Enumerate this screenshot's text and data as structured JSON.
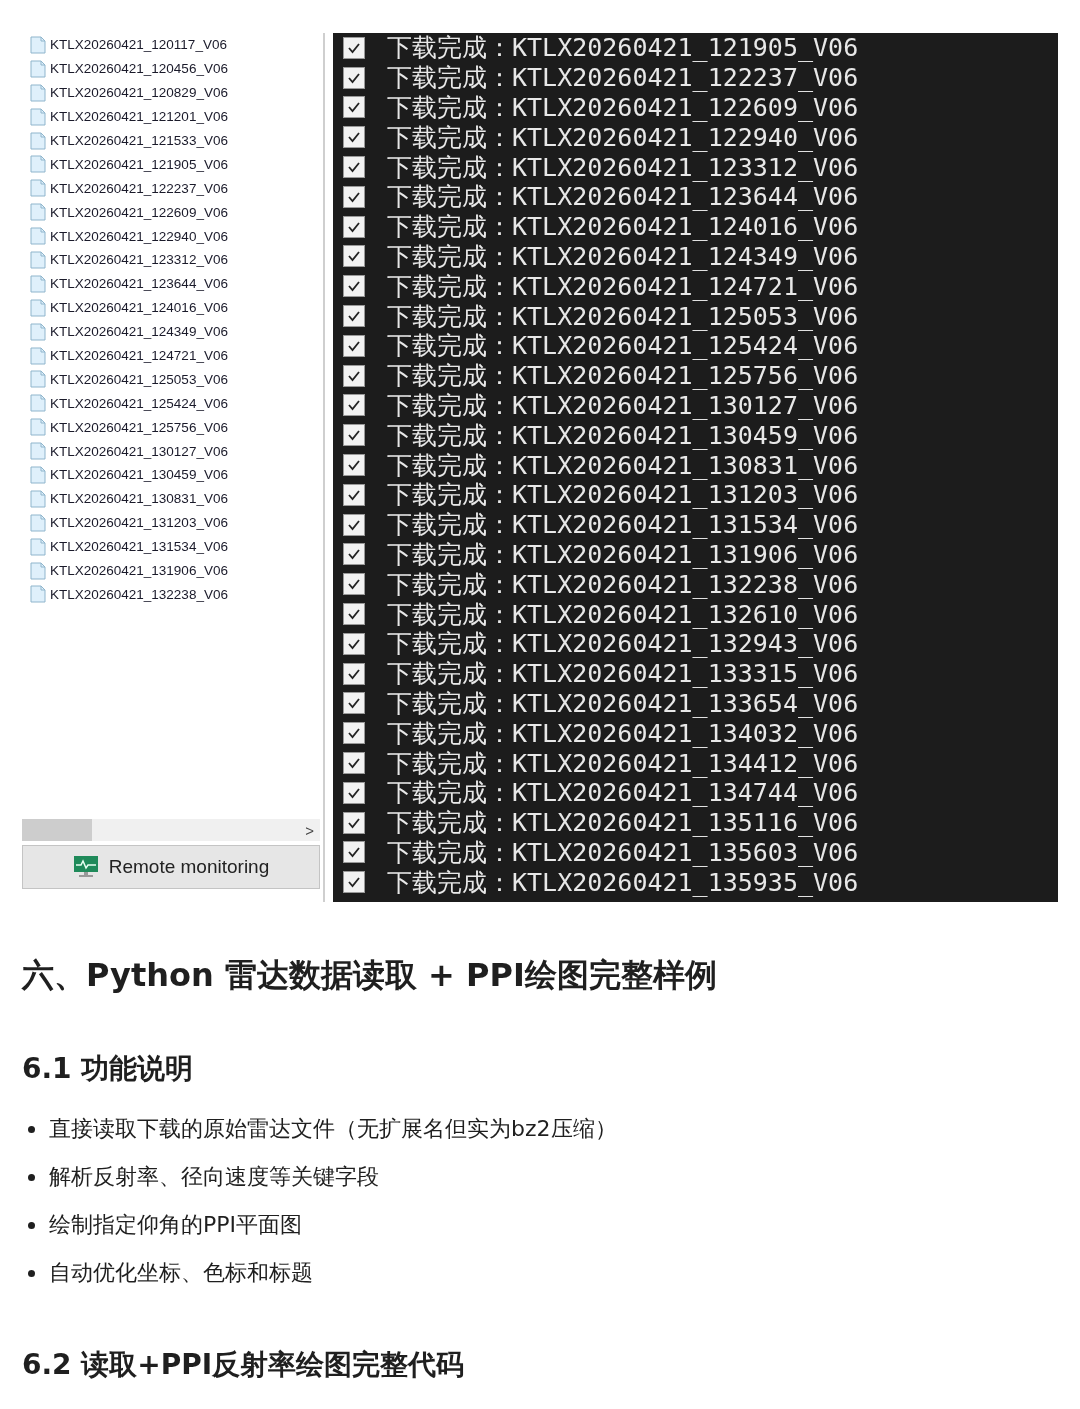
{
  "screenshot": {
    "file_list": [
      "KTLX20260421_120117_V06",
      "KTLX20260421_120456_V06",
      "KTLX20260421_120829_V06",
      "KTLX20260421_121201_V06",
      "KTLX20260421_121533_V06",
      "KTLX20260421_121905_V06",
      "KTLX20260421_122237_V06",
      "KTLX20260421_122609_V06",
      "KTLX20260421_122940_V06",
      "KTLX20260421_123312_V06",
      "KTLX20260421_123644_V06",
      "KTLX20260421_124016_V06",
      "KTLX20260421_124349_V06",
      "KTLX20260421_124721_V06",
      "KTLX20260421_125053_V06",
      "KTLX20260421_125424_V06",
      "KTLX20260421_125756_V06",
      "KTLX20260421_130127_V06",
      "KTLX20260421_130459_V06",
      "KTLX20260421_130831_V06",
      "KTLX20260421_131203_V06",
      "KTLX20260421_131534_V06",
      "KTLX20260421_131906_V06",
      "KTLX20260421_132238_V06"
    ],
    "scroll_arrow": ">",
    "panel_button": "Remote monitoring",
    "terminal_lines": [
      {
        "checked": true,
        "text": "下载完成：KTLX20260421_121905_V06"
      },
      {
        "checked": true,
        "text": "下载完成：KTLX20260421_122237_V06"
      },
      {
        "checked": true,
        "text": "下载完成：KTLX20260421_122609_V06"
      },
      {
        "checked": true,
        "text": "下载完成：KTLX20260421_122940_V06"
      },
      {
        "checked": true,
        "text": "下载完成：KTLX20260421_123312_V06"
      },
      {
        "checked": true,
        "text": "下载完成：KTLX20260421_123644_V06"
      },
      {
        "checked": true,
        "text": "下载完成：KTLX20260421_124016_V06"
      },
      {
        "checked": true,
        "text": "下载完成：KTLX20260421_124349_V06"
      },
      {
        "checked": true,
        "text": "下载完成：KTLX20260421_124721_V06"
      },
      {
        "checked": true,
        "text": "下载完成：KTLX20260421_125053_V06"
      },
      {
        "checked": true,
        "text": "下载完成：KTLX20260421_125424_V06"
      },
      {
        "checked": true,
        "text": "下载完成：KTLX20260421_125756_V06"
      },
      {
        "checked": true,
        "text": "下载完成：KTLX20260421_130127_V06"
      },
      {
        "checked": true,
        "text": "下载完成：KTLX20260421_130459_V06"
      },
      {
        "checked": true,
        "text": "下载完成：KTLX20260421_130831_V06"
      },
      {
        "checked": true,
        "text": "下载完成：KTLX20260421_131203_V06"
      },
      {
        "checked": true,
        "text": "下载完成：KTLX20260421_131534_V06"
      },
      {
        "checked": true,
        "text": "下载完成：KTLX20260421_131906_V06"
      },
      {
        "checked": true,
        "text": "下载完成：KTLX20260421_132238_V06"
      },
      {
        "checked": true,
        "text": "下载完成：KTLX20260421_132610_V06"
      },
      {
        "checked": true,
        "text": "下载完成：KTLX20260421_132943_V06"
      },
      {
        "checked": true,
        "text": "下载完成：KTLX20260421_133315_V06"
      },
      {
        "checked": true,
        "text": "下载完成：KTLX20260421_133654_V06"
      },
      {
        "checked": true,
        "text": "下载完成：KTLX20260421_134032_V06"
      },
      {
        "checked": true,
        "text": "下载完成：KTLX20260421_134412_V06"
      },
      {
        "checked": true,
        "text": "下载完成：KTLX20260421_134744_V06"
      },
      {
        "checked": true,
        "text": "下载完成：KTLX20260421_135116_V06"
      },
      {
        "checked": true,
        "text": "下载完成：KTLX20260421_135603_V06"
      },
      {
        "checked": true,
        "text": "下载完成：KTLX20260421_135935_V06"
      }
    ]
  },
  "section_heading": "六、Python 雷达数据读取 + PPI绘图完整样例",
  "subsection_1": {
    "heading": "6.1 功能说明",
    "bullets": [
      "直接读取下载的原始雷达文件（无扩展名但实为bz2压缩）",
      "解析反射率、径向速度等关键字段",
      "绘制指定仰角的PPI平面图",
      "自动优化坐标、色标和标题"
    ]
  },
  "subsection_2": {
    "heading": "6.2 读取+PPI反射率绘图完整代码"
  }
}
